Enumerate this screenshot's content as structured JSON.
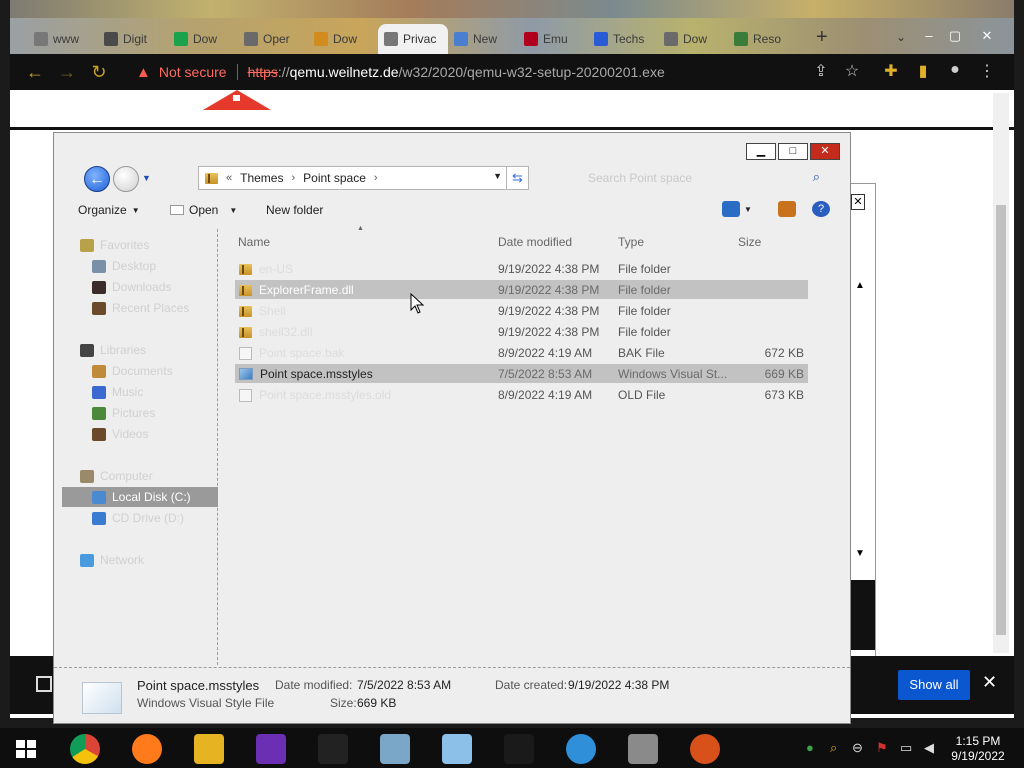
{
  "browser": {
    "tabs": [
      {
        "label": "www",
        "icon": "page-icon",
        "color": "#777777"
      },
      {
        "label": "Digit",
        "icon": "bank-icon",
        "color": "#4a4a4a"
      },
      {
        "label": "Dow",
        "icon": "play-icon",
        "color": "#1aa34a"
      },
      {
        "label": "Oper",
        "icon": "doc-icon",
        "color": "#6a6a6a"
      },
      {
        "label": "Dow",
        "icon": "shield-icon",
        "color": "#d28b1d"
      },
      {
        "label": "Privac",
        "icon": "page-icon",
        "color": "#777777",
        "active": true
      },
      {
        "label": "New",
        "icon": "puzzle-icon",
        "color": "#4a7fd0"
      },
      {
        "label": "Emu",
        "icon": "alpha-icon",
        "color": "#b0001e"
      },
      {
        "label": "Techs",
        "icon": "circle-icon",
        "color": "#2a5bd7"
      },
      {
        "label": "Dow",
        "icon": "doc-icon",
        "color": "#6a6a6a"
      },
      {
        "label": "Reso",
        "icon": "aj-icon",
        "color": "#3a7d3a"
      }
    ],
    "new_tab_glyph": "+",
    "tab_list_glyph": "⌄",
    "tab_close_glyph": "✕",
    "window_controls": {
      "minimize": "–",
      "maximize": "▢",
      "close": "✕"
    },
    "toolbar": {
      "back": "←",
      "forward": "→",
      "reload": "↻"
    },
    "security_label": "Not secure",
    "url": {
      "scheme": "https",
      "host": "qemu.weilnetz.de",
      "path": "/w32/2020/qemu-w32-setup-20200201.exe"
    }
  },
  "download_bar": {
    "show_all_label": "Show all",
    "close_glyph": "✕"
  },
  "dialog": {
    "window_controls": {
      "minimize": "▁",
      "maximize": "□",
      "close": "✕"
    },
    "breadcrumb": {
      "overflow": "«",
      "items": [
        "Themes",
        "Point space"
      ]
    },
    "search_placeholder": "Search Point space",
    "toolbar": {
      "organize": "Organize",
      "open": "Open",
      "new_folder": "New folder"
    },
    "nav_pane": [
      {
        "label": "Favorites",
        "faded": true,
        "color": "#b7a24a"
      },
      {
        "label": "Desktop",
        "faded": true,
        "color": "#7a8fa8"
      },
      {
        "label": "Downloads",
        "faded": true,
        "color": "#3b2b2b"
      },
      {
        "label": "Recent Places",
        "faded": true,
        "color": "#6a4a2a"
      },
      {
        "label": "Libraries",
        "faded": true,
        "color": "#444444"
      },
      {
        "label": "Documents",
        "faded": true,
        "color": "#c08a3a"
      },
      {
        "label": "Music",
        "faded": true,
        "color": "#3a6ad0"
      },
      {
        "label": "Pictures",
        "faded": true,
        "color": "#4a8a3a"
      },
      {
        "label": "Videos",
        "faded": true,
        "color": "#6a4a2a"
      },
      {
        "label": "Computer",
        "faded": true,
        "color": "#9a8a6a"
      },
      {
        "label": "Local Disk (C:)",
        "faded": false,
        "selected": true,
        "color": "#4a8ad0"
      },
      {
        "label": "CD Drive (D:)",
        "faded": true,
        "color": "#3a7ad0"
      },
      {
        "label": "Network",
        "faded": true,
        "color": "#4a9ae0"
      }
    ],
    "columns": [
      "Name",
      "Date modified",
      "Type",
      "Size"
    ],
    "files": [
      {
        "name": "en-US",
        "date": "9/19/2022 4:38 PM",
        "type": "File folder",
        "size": "",
        "kind": "folder",
        "faded": true,
        "highlighted": false
      },
      {
        "name": "ExplorerFrame.dll",
        "date": "9/19/2022 4:38 PM",
        "type": "File folder",
        "size": "",
        "kind": "folder",
        "faded": true,
        "highlighted": true
      },
      {
        "name": "Shell",
        "date": "9/19/2022 4:38 PM",
        "type": "File folder",
        "size": "",
        "kind": "folder",
        "faded": true,
        "highlighted": false
      },
      {
        "name": "shell32.dll",
        "date": "9/19/2022 4:38 PM",
        "type": "File folder",
        "size": "",
        "kind": "folder",
        "faded": true,
        "highlighted": false
      },
      {
        "name": "Point space.bak",
        "date": "8/9/2022 4:19 AM",
        "type": "BAK File",
        "size": "672 KB",
        "kind": "file",
        "faded": true,
        "highlighted": false
      },
      {
        "name": "Point space.msstyles",
        "date": "7/5/2022 8:53 AM",
        "type": "Windows Visual St...",
        "size": "669 KB",
        "kind": "msstyles",
        "faded": false,
        "highlighted": true
      },
      {
        "name": "Point space.msstyles.old",
        "date": "8/9/2022 4:19 AM",
        "type": "OLD File",
        "size": "673 KB",
        "kind": "file",
        "faded": true,
        "highlighted": false
      }
    ],
    "details": {
      "name": "Point space.msstyles",
      "type": "Windows Visual Style File",
      "date_modified_label": "Date modified:",
      "date_modified": "7/5/2022 8:53 AM",
      "date_created_label": "Date created:",
      "date_created": "9/19/2022 4:38 PM",
      "size_label": "Size:",
      "size": "669 KB"
    }
  },
  "taskbar": {
    "apps": [
      {
        "name": "chrome-icon",
        "color": "#e0a800"
      },
      {
        "name": "firefox-icon",
        "color": "#ff7a1a"
      },
      {
        "name": "file-explorer-icon",
        "color": "#e6b422"
      },
      {
        "name": "yahoo-icon",
        "color": "#6b2fb3"
      },
      {
        "name": "cmd-icon",
        "color": "#222222"
      },
      {
        "name": "notepad-icon",
        "color": "#7aa7c7"
      },
      {
        "name": "paint-icon",
        "color": "#8cc0e8"
      },
      {
        "name": "7zip-icon",
        "color": "#1a1a1a"
      },
      {
        "name": "network-globe-icon",
        "color": "#2f8fd8"
      },
      {
        "name": "plane-icon",
        "color": "#8a8a8a"
      },
      {
        "name": "music-app-icon",
        "color": "#d8501a"
      }
    ],
    "tray_icons": [
      "network-icon",
      "search-icon",
      "minus-circle-icon",
      "flag-icon",
      "display-icon",
      "volume-icon"
    ],
    "time": "1:15 PM",
    "date": "9/19/2022"
  }
}
